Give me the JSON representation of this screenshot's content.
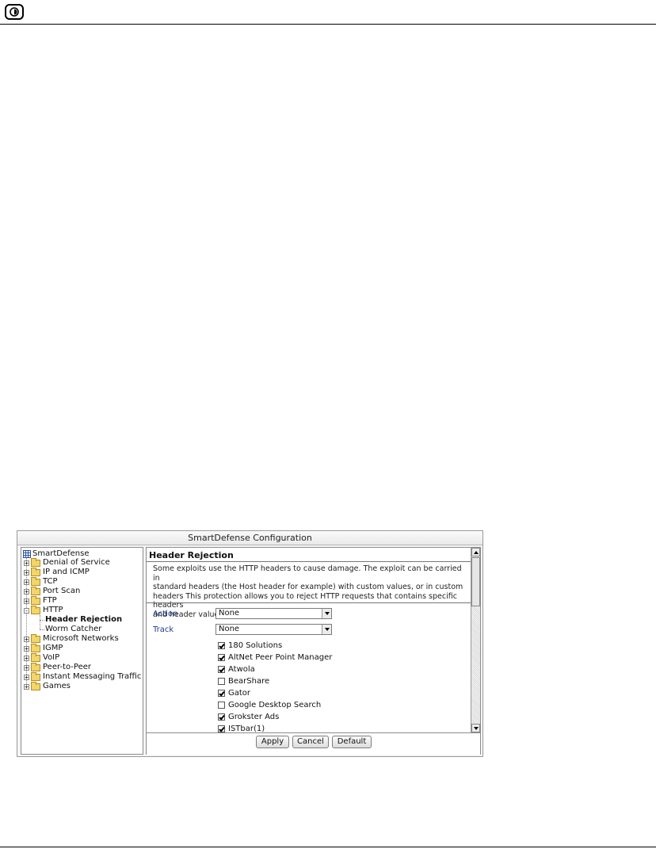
{
  "window": {
    "title": "SmartDefense Configuration"
  },
  "tree": {
    "root": "SmartDefense",
    "items": [
      {
        "label": "Denial of Service"
      },
      {
        "label": "IP and ICMP"
      },
      {
        "label": "TCP"
      },
      {
        "label": "Port Scan"
      },
      {
        "label": "FTP"
      },
      {
        "label": "HTTP",
        "expanded": true,
        "children": [
          {
            "label": "Header Rejection",
            "selected": true
          },
          {
            "label": "Worm Catcher"
          }
        ]
      },
      {
        "label": "Microsoft Networks"
      },
      {
        "label": "IGMP"
      },
      {
        "label": "VoIP"
      },
      {
        "label": "Peer-to-Peer"
      },
      {
        "label": "Instant Messaging Traffic"
      },
      {
        "label": "Games"
      }
    ]
  },
  "detail": {
    "title": "Header Rejection",
    "description": [
      "Some exploits use the HTTP headers to cause damage. The exploit can be carried in",
      "standard headers (the Host header for example) with custom values, or in custom",
      "headers This protection allows you to reject HTTP requests that contains specific headers",
      "and header values."
    ],
    "action": {
      "label": "Action",
      "value": "None"
    },
    "track": {
      "label": "Track",
      "value": "None"
    },
    "headers": [
      {
        "label": "180 Solutions",
        "checked": true
      },
      {
        "label": "AltNet Peer Point Manager",
        "checked": true
      },
      {
        "label": "Atwola",
        "checked": true
      },
      {
        "label": "BearShare",
        "checked": false
      },
      {
        "label": "Gator",
        "checked": true
      },
      {
        "label": "Google Desktop Search",
        "checked": false
      },
      {
        "label": "Grokster Ads",
        "checked": true
      },
      {
        "label": "ISTbar(1)",
        "checked": true
      }
    ]
  },
  "buttons": {
    "apply": "Apply",
    "cancel": "Cancel",
    "default": "Default"
  }
}
